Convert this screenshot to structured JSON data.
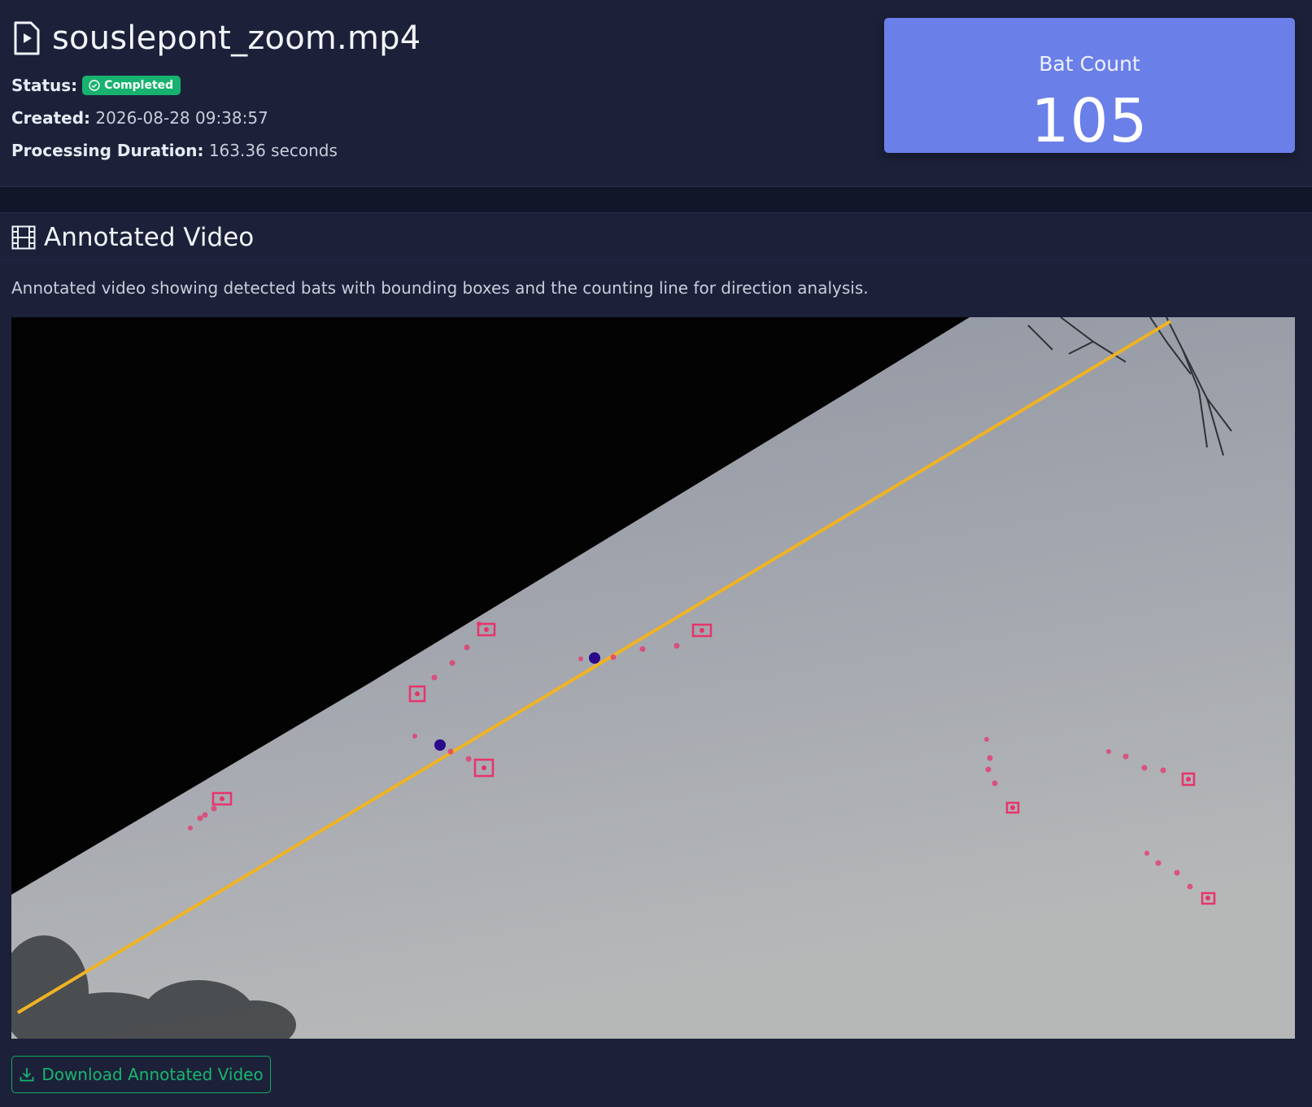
{
  "header": {
    "filename": "souslepont_zoom.mp4",
    "file_icon": "file-video-icon",
    "status_label": "Status:",
    "status_value": "Completed",
    "created_label": "Created:",
    "created_value": "2026-08-28 09:38:57",
    "duration_label": "Processing Duration:",
    "duration_value": "163.36 seconds"
  },
  "stat": {
    "label": "Bat Count",
    "value": "105",
    "color": "#6a7fe8"
  },
  "video_section": {
    "icon": "film-icon",
    "title": "Annotated Video",
    "description": "Annotated video showing detected bats with bounding boxes and the counting line for direction analysis.",
    "download_label": "Download Annotated Video",
    "download_icon": "download-icon"
  },
  "colors": {
    "status_green": "#17b26f",
    "counting_line": "#f0b323",
    "bounding_box": "#e8336b",
    "crossing_point": "#2a0a8a"
  }
}
